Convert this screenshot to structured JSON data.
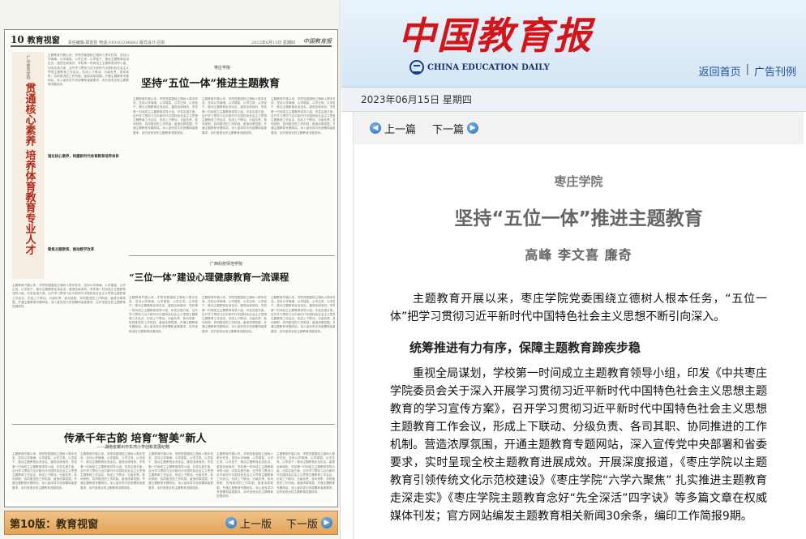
{
  "left": {
    "page_header": {
      "page_number": "10",
      "section": "教育视窗",
      "meta": "责任编辑:郑芸芸  电话:010-82296682  版式设计:吕彩",
      "date": "2023年6月15日  星期四",
      "paper_logo": "中国教育报"
    },
    "side_title": {
      "school": "广州体育学院",
      "headline": "贯通核心素养 培养体育教育专业人才"
    },
    "articles": [
      {
        "school": "枣庄学院",
        "headline": "坚持“五位一体”推进主题教育"
      },
      {
        "school": "广西科技师范学院",
        "headline": "“三位一体”建设心理健康教育一流课程"
      },
      {
        "school": "",
        "headline": "传承千年古韵 培育“智美”新人",
        "subhead": "——湖南省郴州市东湾小学创新发展纪略"
      }
    ],
    "sub_heads": [
      "强化核心素养，构建新时代体育教育培养体系",
      "聚焦主题教育，推动教学改革"
    ],
    "column_text": "主题教育开展以来，学院党委围绕立德树人根本任务，坚持以学铸魂、以学增智、以学正风、以学促干，推动主题教育走深走实。重视全局谋划，学校第一时间成立主题教育领导小组，印发实施方案，召开学习贯彻习近平新时代中国特色社会主义思想主题教育工作会议，形成上下联动、分级负责、各司其职、协同推进的工作机制。营造浓厚氛围，开通主题教育专题网站，深入宣传党中央部署和省委要求，实时呈现全校主题教育进展成效。",
    "bottom_bar": {
      "edition_label": "第10版：教育视窗",
      "prev_label": "上一版",
      "next_label": "下一版"
    }
  },
  "right": {
    "masthead": {
      "logo_cn": "中国教育报",
      "logo_en": "CHINA EDUCATION DAILY"
    },
    "top_links": {
      "home": "返回首页",
      "separator": "|",
      "ads": "广告刊例"
    },
    "date_line": "2023年06月15日 星期四",
    "nav": {
      "prev": "上一篇",
      "next": "下一篇"
    },
    "article": {
      "school": "枣庄学院",
      "title": "坚持“五位一体”推进主题教育",
      "authors": "高峰  李文喜  廉奇",
      "paragraphs": [
        "主题教育开展以来，枣庄学院党委围绕立德树人根本任务，“五位一体”把学习贯彻习近平新时代中国特色社会主义思想不断引向深入。",
        "重视全局谋划，学校第一时间成立主题教育领导小组，印发《中共枣庄学院委员会关于深入开展学习贯彻习近平新时代中国特色社会主义思想主题教育的学习宣传方案》，召开学习贯彻习近平新时代中国特色社会主义思想主题教育工作会议，形成上下联动、分级负责、各司其职、协同推进的工作机制。营造浓厚氛围，开通主题教育专题网站，深入宣传党中央部署和省委要求，实时呈现全校主题教育进展成效。开展深度报道，《枣庄学院以主题教育引领传统文化示范校建设》《枣庄学院“六学六聚焦” 扎实推进主题教育走深走实》《枣庄学院主题教育念好“先全深活”四字诀》等多篇文章在权威媒体刊发；官方网站编发主题教育相关新闻30余条，编印工作简报9期。"
      ],
      "section_heading": "统筹推进有力有序，保障主题教育蹄疾步稳"
    }
  }
}
